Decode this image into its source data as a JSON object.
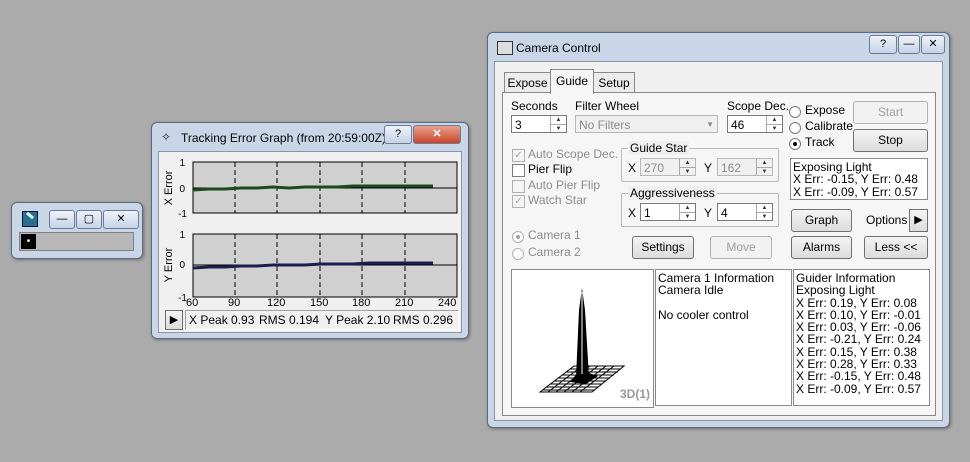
{
  "mini_window": {
    "icon": "phd-app-icon",
    "minimize_label": "—",
    "maximize_label": "▢",
    "close_label": "✕",
    "indicator_label": "•"
  },
  "tracking_window": {
    "title": "Tracking Error Graph (from 20:59:00Z)",
    "help_label": "?",
    "close_label": "✕",
    "y_axis_x_label": "X Error",
    "y_axis_y_label": "Y Error",
    "yticks": [
      "1",
      "0",
      "-1"
    ],
    "xticks": [
      "60",
      "90",
      "120",
      "150",
      "180",
      "210",
      "240"
    ],
    "play_label": "▶",
    "stats": {
      "x_peak": "X Peak 0.93",
      "x_rms": "RMS 0.194",
      "y_peak": "Y Peak 2.10",
      "y_rms": "RMS 0.296"
    },
    "colors": {
      "x_series": "#1d4a1d",
      "y_series": "#1c1c4e",
      "plot_bg": "#d0d0d0"
    }
  },
  "camera_window": {
    "title": "Camera Control",
    "help_label": "?",
    "minimize_label": "—",
    "close_label": "✕",
    "tabs": [
      "Expose",
      "Guide",
      "Setup"
    ],
    "active_tab": "Guide",
    "seconds_label": "Seconds",
    "seconds_value": "3",
    "filter_wheel_label": "Filter Wheel",
    "filter_wheel_value": "No Filters",
    "scope_dec_label": "Scope Dec.",
    "scope_dec_value": "46",
    "mode_options": [
      "Expose",
      "Calibrate",
      "Track"
    ],
    "mode_selected": "Track",
    "start_label": "Start",
    "stop_label": "Stop",
    "auto_scope_dec": "Auto Scope Dec.",
    "pier_flip": "Pier Flip",
    "auto_pier_flip": "Auto Pier Flip",
    "watch_star": "Watch Star",
    "guide_star_label": "Guide Star",
    "guide_x_label": "X",
    "guide_x_value": "270",
    "guide_y_label": "Y",
    "guide_y_value": "162",
    "aggressiveness_label": "Aggressiveness",
    "aggr_x_label": "X",
    "aggr_x_value": "1",
    "aggr_y_label": "Y",
    "aggr_y_value": "4",
    "status_lines": [
      "Exposing Light",
      "X Err: -0.15, Y Err: 0.48",
      "X Err: -0.09, Y Err: 0.57"
    ],
    "graph_label": "Graph",
    "options_label": "Options",
    "options_arrow": "▶",
    "alarms_label": "Alarms",
    "less_label": "Less <<",
    "settings_label": "Settings",
    "move_label": "Move",
    "camera1_label": "Camera 1",
    "camera2_label": "Camera 2",
    "view_3d_label": "3D(1)",
    "camera_info": [
      "Camera 1 Information",
      "Camera Idle",
      "",
      "No cooler control"
    ],
    "guider_info": [
      "Guider Information",
      "Exposing Light",
      "X Err: 0.19, Y Err: 0.08",
      "X Err: 0.10, Y Err: -0.01",
      "X Err: 0.03, Y Err: -0.06",
      "X Err: -0.21, Y Err: 0.24",
      "X Err: 0.15, Y Err: 0.38",
      "X Err: 0.28, Y Err: 0.33",
      "X Err: -0.15, Y Err: 0.48",
      "X Err: -0.09, Y Err: 0.57"
    ]
  }
}
